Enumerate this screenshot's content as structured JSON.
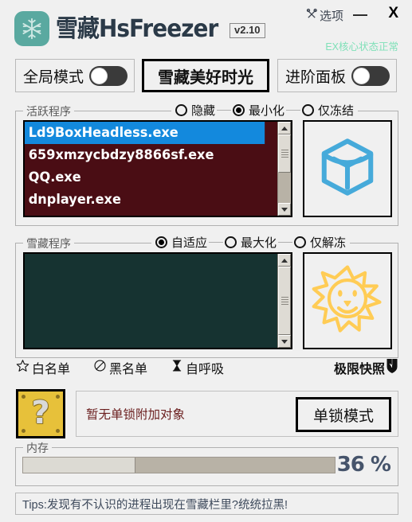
{
  "window": {
    "app_name": "雪藏HsFreezer",
    "version": "v2.10",
    "options_label": "选项",
    "minimize_label": "—",
    "close_label": "X",
    "core_status": "EX核心状态正常",
    "app_icon": "snowflake-icon",
    "options_icon": "crossed-tools-icon"
  },
  "controls": {
    "global_mode_label": "全局模式",
    "global_mode_state": "off",
    "freeze_button_label": "雪藏美好时光",
    "advanced_panel_label": "进阶面板",
    "advanced_panel_state": "off"
  },
  "active_group": {
    "legend": "活跃程序",
    "radios": [
      {
        "label": "隐藏",
        "selected": false
      },
      {
        "label": "最小化",
        "selected": true
      },
      {
        "label": "仅冻结",
        "selected": false
      }
    ],
    "items": [
      {
        "name": "Ld9BoxHeadless.exe",
        "selected": true
      },
      {
        "name": "659xmzycbdzy8866sf.exe",
        "selected": false
      },
      {
        "name": "QQ.exe",
        "selected": false
      },
      {
        "name": "dnplayer.exe",
        "selected": false
      }
    ],
    "icon": "hex-box-icon",
    "colors": {
      "list_bg": "#4a0d14",
      "selection": "#1389dd",
      "icon": "#46aada"
    }
  },
  "frozen_group": {
    "legend": "雪藏程序",
    "radios": [
      {
        "label": "自适应",
        "selected": true
      },
      {
        "label": "最大化",
        "selected": false
      },
      {
        "label": "仅解冻",
        "selected": false
      }
    ],
    "items": [],
    "icon": "sun-smile-icon",
    "colors": {
      "list_bg": "#163331",
      "icon": "#ffcc55"
    }
  },
  "links": [
    {
      "label": "白名单",
      "icon": "star-icon"
    },
    {
      "label": "黑名单",
      "icon": "prohibited-icon"
    },
    {
      "label": "自呼吸",
      "icon": "hourglass-icon"
    }
  ],
  "snapshot": {
    "label": "极限快照",
    "icon": "shield-icon"
  },
  "lock": {
    "block_icon": "question-block-icon",
    "question_mark": "?",
    "status_text": "暂无单锁附加对象",
    "button_label": "单锁模式"
  },
  "memory": {
    "legend": "内存",
    "percent_label": "36 %",
    "percent_value": 36
  },
  "tips": {
    "text": "Tips:发现有不认识的进程出现在雪藏栏里?统统拉黑!"
  }
}
